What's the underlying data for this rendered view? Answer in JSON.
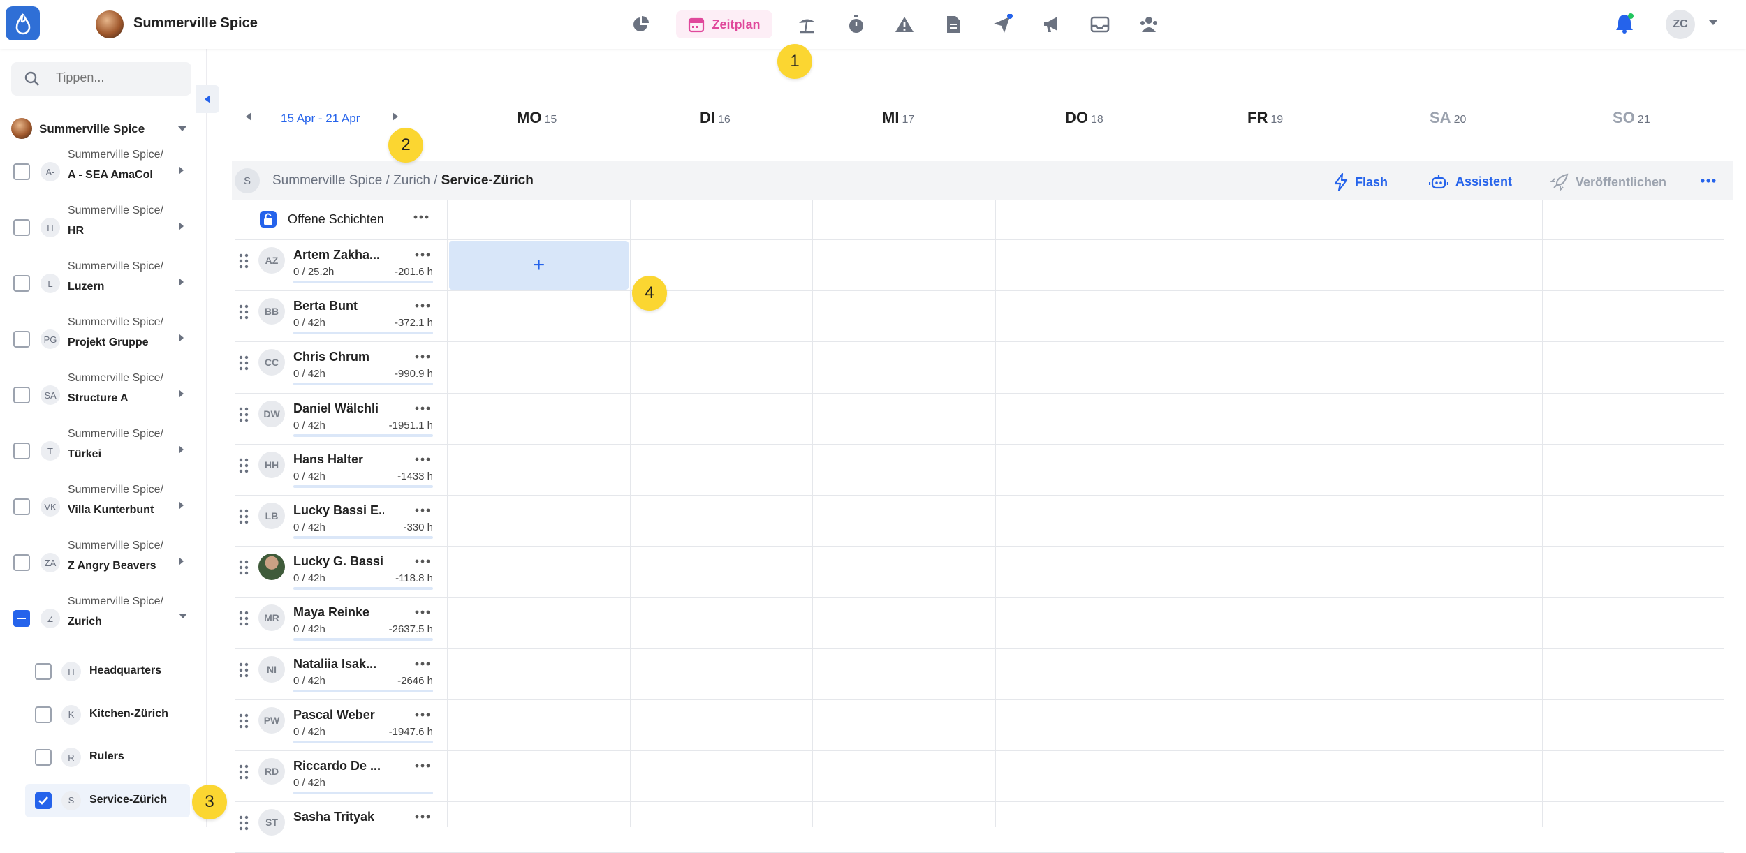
{
  "app": {
    "brand_name": "Summerville Spice",
    "user_initials": "ZC",
    "active_nav_label": "Zeitplan"
  },
  "nav_icons": [
    "dashboard-icon",
    "calendar-icon",
    "vacation-icon",
    "timer-icon",
    "warning-icon",
    "document-icon",
    "send-icon",
    "megaphone-icon",
    "inbox-icon",
    "team-icon"
  ],
  "markers": [
    "1",
    "2",
    "3",
    "4"
  ],
  "sidebar": {
    "search_placeholder": "Tippen...",
    "org_name": "Summerville Spice",
    "locations": [
      {
        "initials": "A-",
        "prefix": "Summerville Spice/",
        "name": "A - SEA AmaCol"
      },
      {
        "initials": "H",
        "prefix": "Summerville Spice/",
        "name": "HR"
      },
      {
        "initials": "L",
        "prefix": "Summerville Spice/",
        "name": "Luzern"
      },
      {
        "initials": "PG",
        "prefix": "Summerville Spice/",
        "name": "Projekt Gruppe"
      },
      {
        "initials": "SA",
        "prefix": "Summerville Spice/",
        "name": "Structure A"
      },
      {
        "initials": "T",
        "prefix": "Summerville Spice/",
        "name": "Türkei"
      },
      {
        "initials": "VK",
        "prefix": "Summerville Spice/",
        "name": "Villa Kunterbunt"
      },
      {
        "initials": "ZA",
        "prefix": "Summerville Spice/",
        "name": "Z Angry Beavers"
      },
      {
        "initials": "Z",
        "prefix": "Summerville Spice/",
        "name": "Zurich"
      }
    ],
    "sub_locations": [
      {
        "initials": "H",
        "name": "Headquarters"
      },
      {
        "initials": "K",
        "name": "Kitchen-Zürich"
      },
      {
        "initials": "R",
        "name": "Rulers"
      },
      {
        "initials": "S",
        "name": "Service-Zürich"
      }
    ]
  },
  "week": {
    "range": "15 Apr - 21 Apr",
    "days": [
      {
        "name": "MO",
        "date": "15"
      },
      {
        "name": "DI",
        "date": "16"
      },
      {
        "name": "MI",
        "date": "17"
      },
      {
        "name": "DO",
        "date": "18"
      },
      {
        "name": "FR",
        "date": "19"
      },
      {
        "name": "SA",
        "date": "20"
      },
      {
        "name": "SO",
        "date": "21"
      }
    ]
  },
  "breadcrumb": {
    "initial": "S",
    "path": "Summerville Spice / Zurich / ",
    "current": "Service-Zürich",
    "flash_label": "Flash",
    "assistant_label": "Assistent",
    "publish_label": "Veröffentlichen"
  },
  "schedule": {
    "open_shifts_label": "Offene Schichten",
    "employees": [
      {
        "initials": "AZ",
        "name": "Artem Zakha...",
        "hours": "0 / 25.2h",
        "balance": "-201.6 h"
      },
      {
        "initials": "BB",
        "name": "Berta Bunt",
        "hours": "0 / 42h",
        "balance": "-372.1 h"
      },
      {
        "initials": "CC",
        "name": "Chris Chrum",
        "hours": "0 / 42h",
        "balance": "-990.9 h"
      },
      {
        "initials": "DW",
        "name": "Daniel Wälchli",
        "hours": "0 / 42h",
        "balance": "-1951.1 h"
      },
      {
        "initials": "HH",
        "name": "Hans Halter",
        "hours": "0 / 42h",
        "balance": "-1433 h"
      },
      {
        "initials": "LB",
        "name": "Lucky Bassi E...",
        "hours": "0 / 42h",
        "balance": "-330 h"
      },
      {
        "initials": "",
        "name": "Lucky G. Bassi",
        "hours": "0 / 42h",
        "balance": "-118.8 h"
      },
      {
        "initials": "MR",
        "name": "Maya Reinke",
        "hours": "0 / 42h",
        "balance": "-2637.5 h"
      },
      {
        "initials": "NI",
        "name": "Nataliia Isak...",
        "hours": "0 / 42h",
        "balance": "-2646 h"
      },
      {
        "initials": "PW",
        "name": "Pascal Weber",
        "hours": "0 / 42h",
        "balance": "-1947.6 h"
      },
      {
        "initials": "RD",
        "name": "Riccardo De ...",
        "hours": "0 / 42h",
        "balance": ""
      },
      {
        "initials": "ST",
        "name": "Sasha Trityak",
        "hours": "",
        "balance": ""
      }
    ],
    "add_symbol": "+"
  }
}
